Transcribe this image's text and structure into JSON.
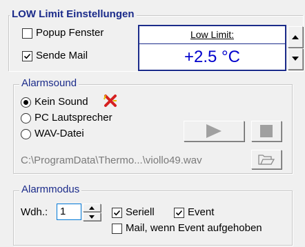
{
  "low_limit_group": {
    "title": "LOW Limit Einstellungen",
    "popup_checkbox": {
      "label": "Popup Fenster",
      "checked": false
    },
    "mail_checkbox": {
      "label": "Sende Mail",
      "checked": true
    },
    "limit_label": "Low Limit:",
    "limit_value": "+2.5 °C",
    "accent_color": "#1b2b8a",
    "value_color": "#0000cc"
  },
  "alarmsound_group": {
    "title": "Alarmsound",
    "radios": [
      {
        "label": "Kein Sound",
        "selected": true
      },
      {
        "label": "PC Lautsprecher",
        "selected": false
      },
      {
        "label": "WAV-Datei",
        "selected": false
      }
    ],
    "file_path": "C:\\ProgramData\\Thermo...\\viollo49.wav",
    "muted_icon": "red-x-icon",
    "play_icon": "play-icon",
    "stop_icon": "stop-icon",
    "browse_icon": "folder-open-icon"
  },
  "alarmmodus_group": {
    "title": "Alarmmodus",
    "repeat_label": "Wdh.:",
    "repeat_value": "1",
    "seriell": {
      "label": "Seriell",
      "checked": true
    },
    "event": {
      "label": "Event",
      "checked": true
    },
    "mail_event": {
      "label": "Mail, wenn Event aufgehoben",
      "checked": false
    }
  }
}
